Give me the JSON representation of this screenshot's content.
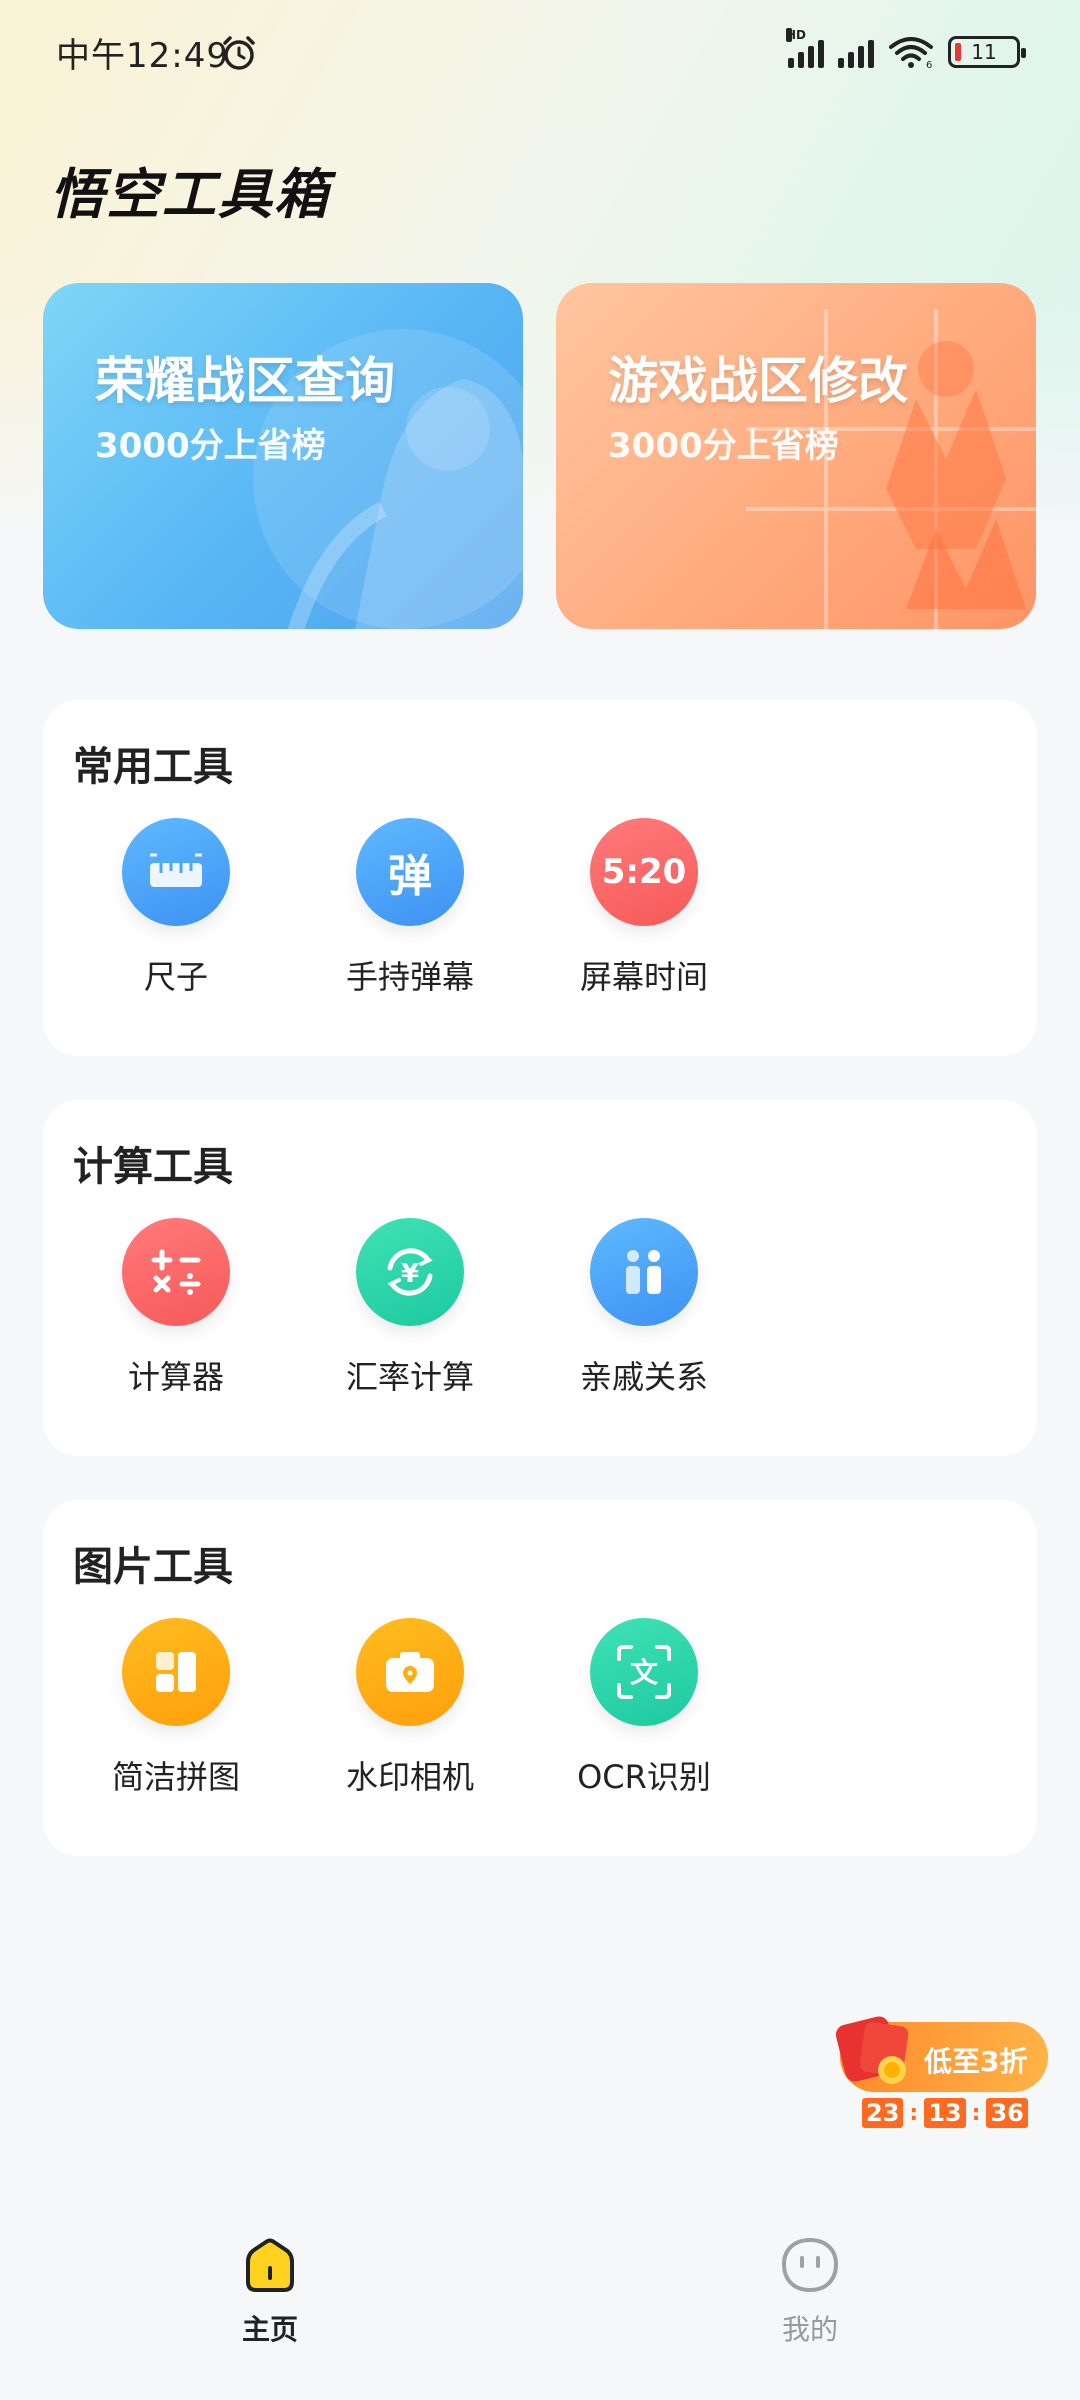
{
  "status_bar": {
    "time": "中午12:49",
    "network_label": "HD",
    "battery": "11",
    "wifi_sub": "6"
  },
  "header": {
    "title": "悟空工具箱"
  },
  "banners": [
    {
      "title": "荣耀战区查询",
      "subtitle": "3000分上省榜"
    },
    {
      "title": "游戏战区修改",
      "subtitle": "3000分上省榜"
    }
  ],
  "sections": [
    {
      "title": "常用工具",
      "items": [
        {
          "label": "尺子",
          "icon": "ruler-icon",
          "color": "#4aa6f7"
        },
        {
          "label": "手持弹幕",
          "icon": "barrage-icon",
          "glyph": "弹",
          "color": "#4aa6f7"
        },
        {
          "label": "屏幕时间",
          "icon": "screen-time-icon",
          "glyph": "5:20",
          "color": "#f96767"
        }
      ]
    },
    {
      "title": "计算工具",
      "items": [
        {
          "label": "计算器",
          "icon": "calculator-icon",
          "color": "#f96767"
        },
        {
          "label": "汇率计算",
          "icon": "exchange-rate-icon",
          "glyph": "¥",
          "color": "#28d3a8"
        },
        {
          "label": "亲戚关系",
          "icon": "relatives-icon",
          "color": "#4aa6f7"
        }
      ]
    },
    {
      "title": "图片工具",
      "items": [
        {
          "label": "简洁拼图",
          "icon": "collage-icon",
          "color": "#ffae12"
        },
        {
          "label": "水印相机",
          "icon": "watermark-camera-icon",
          "color": "#ffae12"
        },
        {
          "label": "OCR识别",
          "icon": "ocr-icon",
          "glyph": "文",
          "color": "#28d3a8"
        }
      ]
    }
  ],
  "promo": {
    "text": "低至3折",
    "countdown": [
      "23",
      "13",
      "36"
    ],
    "separator": ":"
  },
  "bottom_nav": [
    {
      "label": "主页",
      "active": true
    },
    {
      "label": "我的",
      "active": false
    }
  ]
}
